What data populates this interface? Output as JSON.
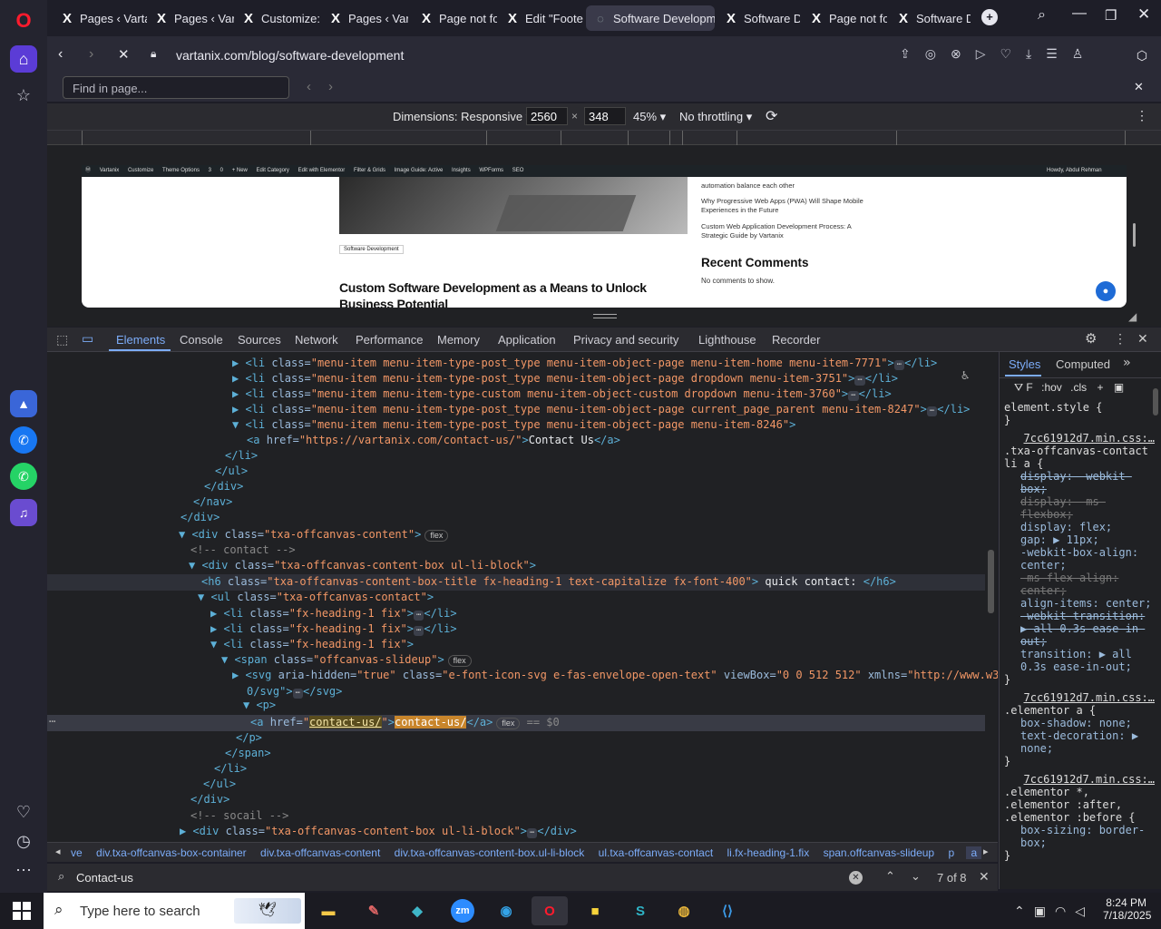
{
  "tabs": [
    {
      "label": "Pages ‹ Varta",
      "icon": "x"
    },
    {
      "label": "Pages ‹ Varta",
      "icon": "x"
    },
    {
      "label": "Customize: V",
      "icon": "x"
    },
    {
      "label": "Pages ‹ Varta",
      "icon": "x"
    },
    {
      "label": "Page not fou",
      "icon": "x"
    },
    {
      "label": "Edit \"Footer",
      "icon": "x"
    },
    {
      "label": "Software Developme",
      "icon": "spinner"
    },
    {
      "label": "Software De",
      "icon": "x"
    },
    {
      "label": "Page not fou",
      "icon": "x"
    },
    {
      "label": "Software De",
      "icon": "x"
    }
  ],
  "address": {
    "url": "vartanix.com/blog/software-development"
  },
  "find": {
    "placeholder": "Find in page..."
  },
  "device": {
    "dimensions": "Dimensions: Responsive",
    "width": "2560",
    "height": "348",
    "zoom": "45%",
    "throttle": "No throttling"
  },
  "page": {
    "adminbar": [
      "Vartanix",
      "Customize",
      "Theme Options",
      "3",
      "0",
      "+ New",
      "Edit Category",
      "Edit with Elementor",
      "Filter & Grids",
      "Image Guide: Active",
      "Insights",
      "WPForms",
      "SEO"
    ],
    "greeting": "Howdy, Abdul Rehman",
    "category": "Software Development",
    "post_title": "Custom Software Development as a Means to Unlock Business Potential",
    "side_top": "automation balance each other",
    "side_link1": "Why Progressive Web Apps (PWA) Will Shape Mobile Experiences in the Future",
    "side_link2": "Custom Web Application Development Process: A Strategic Guide by Vartanix",
    "recent_title": "Recent Comments",
    "recent_text": "No comments to show."
  },
  "devtools": {
    "tabs": [
      "Elements",
      "Console",
      "Sources",
      "Network",
      "Performance",
      "Memory",
      "Application",
      "Privacy and security",
      "Lighthouse",
      "Recorder"
    ],
    "side_tabs": [
      "Styles",
      "Computed"
    ],
    "filter": "F",
    "hov": ":hov",
    "cls": ".cls"
  },
  "dom": [
    {
      "pre": "▶ <li ",
      "a": "class=",
      "v": "\"menu-item menu-item-type-post_type menu-item-object-page menu-item-home menu-item-7771\"",
      "post": ">",
      "ell": true,
      "end": "</li>"
    },
    {
      "pre": "▶ <li ",
      "a": "class=",
      "v": "\"menu-item menu-item-type-post_type menu-item-object-page dropdown menu-item-3751\"",
      "post": ">",
      "ell": true,
      "end": "</li>"
    },
    {
      "pre": "▶ <li ",
      "a": "class=",
      "v": "\"menu-item menu-item-type-custom menu-item-object-custom dropdown menu-item-3760\"",
      "post": ">",
      "ell": true,
      "end": "</li>"
    },
    {
      "pre": "▶ <li ",
      "a": "class=",
      "v": "\"menu-item menu-item-type-post_type menu-item-object-page current_page_parent menu-item-8247\"",
      "post": ">",
      "ell": true,
      "end": "</li>"
    },
    {
      "pre": "▼ <li ",
      "a": "class=",
      "v": "\"menu-item menu-item-type-post_type menu-item-object-page menu-item-8246\"",
      "post": ">"
    },
    {
      "pre": "<a ",
      "a": "href=",
      "v": "\"https://vartanix.com/contact-us/\"",
      "post": ">",
      "text": "Contact Us",
      "end": "</a>"
    },
    {
      "pre": "</li>"
    },
    {
      "pre": "</ul>"
    },
    {
      "pre": "</div>"
    },
    {
      "pre": "</nav>"
    },
    {
      "pre": "</div>"
    },
    {
      "pre": "▼ <div ",
      "a": "class=",
      "v": "\"txa-offcanvas-content\"",
      "post": ">",
      "badge": "flex"
    },
    {
      "pre": "<!-- contact -->",
      "comment": true
    },
    {
      "pre": "▼ <div ",
      "a": "class=",
      "v": "\"txa-offcanvas-content-box  ul-li-block\"",
      "post": ">"
    },
    {
      "pre": "<h6 ",
      "a": "class=",
      "v": "\"txa-offcanvas-content-box-title fx-heading-1 text-capitalize fx-font-400\"",
      "post": ">",
      "text": " quick contact: ",
      "end": "</h6>"
    },
    {
      "pre": "▼ <ul ",
      "a": "class=",
      "v": "\"txa-offcanvas-contact\"",
      "post": ">"
    },
    {
      "pre": "▶ <li ",
      "a": "class=",
      "v": "\"fx-heading-1 fix\"",
      "post": ">",
      "ell": true,
      "end": "</li>"
    },
    {
      "pre": "▶ <li ",
      "a": "class=",
      "v": "\"fx-heading-1 fix\"",
      "post": ">",
      "ell": true,
      "end": "</li>"
    },
    {
      "pre": "▼ <li ",
      "a": "class=",
      "v": "\"fx-heading-1 fix\"",
      "post": ">"
    },
    {
      "pre": "▼ <span ",
      "a": "class=",
      "v": "\"offcanvas-slideup\"",
      "post": ">",
      "badge": "flex"
    },
    {
      "pre": "▶ <svg ",
      "a": "aria-hidden=",
      "v": "\"true\"",
      "a2": " class=",
      "v2": "\"e-font-icon-svg e-fas-envelope-open-text\"",
      "a3": " viewBox=",
      "v3": "\"0 0 512 512\"",
      "a4": " xmlns=",
      "v4": "\"http://www.w3.org/200"
    },
    {
      "pre": "0/svg\"",
      "post": ">",
      "ell": true,
      "end": "</svg>",
      "cont": true
    },
    {
      "pre": "▼ <p>"
    },
    {
      "pre": "<a ",
      "a": "href=",
      "v": "\"contact-us/\"",
      "post": ">",
      "text": "contact-us/",
      "end": "</a>",
      "badge": "flex",
      "dollar": " == $0",
      "selected": true
    },
    {
      "pre": "</p>"
    },
    {
      "pre": "</span>"
    },
    {
      "pre": "</li>"
    },
    {
      "pre": "</ul>"
    },
    {
      "pre": "</div>"
    },
    {
      "pre": "<!-- socail -->",
      "comment": true
    },
    {
      "pre": "▶ <div ",
      "a": "class=",
      "v": "\"txa-offcanvas-content-box ul-li-block\"",
      "post": ">",
      "ell": true,
      "end": "</div>"
    }
  ],
  "styles": {
    "element_style": "element.style {",
    "r1_src": "7cc61912d7.min.css:…",
    "r1_sel": ".txa-offcanvas-contact li a {",
    "r1_props": [
      {
        "t": "display: -webkit-box;",
        "s": true
      },
      {
        "t": "display: -ms-flexbox;",
        "s": true,
        "dim": true
      },
      {
        "t": "display: flex;",
        "s": false
      },
      {
        "t": "gap: ▶ 11px;",
        "s": false
      },
      {
        "t": "-webkit-box-align: center;",
        "s": false
      },
      {
        "t": "-ms-flex-align: center;",
        "s": true,
        "dim": true
      },
      {
        "t": "align-items: center;",
        "s": false
      },
      {
        "t": "-webkit-transition: ▶ all 0.3s ease-in-out;",
        "s": true
      },
      {
        "t": "transition: ▶ all 0.3s ease-in-out;",
        "s": false
      }
    ],
    "r2_src": "7cc61912d7.min.css:…",
    "r2_sel": ".elementor a {",
    "r2_props": [
      "box-shadow: none;",
      "text-decoration: ▶ none;"
    ],
    "r3_src": "7cc61912d7.min.css:…",
    "r3_sel": ".elementor *, .elementor :after, .elementor :before {",
    "r3_props": [
      "box-sizing: border-box;"
    ]
  },
  "breadcrumbs": [
    "ve",
    "div.txa-offcanvas-box-container",
    "div.txa-offcanvas-content",
    "div.txa-offcanvas-content-box.ul-li-block",
    "ul.txa-offcanvas-contact",
    "li.fx-heading-1.fix",
    "span.offcanvas-slideup",
    "p",
    "a"
  ],
  "search": {
    "value": "Contact-us",
    "count": "7 of 8"
  },
  "taskbar": {
    "search_placeholder": "Type here to search",
    "time": "8:24 PM",
    "date": "7/18/2025"
  },
  "colors": {
    "accent": "#ff1b2d",
    "dev_blue": "#7cacf8",
    "highlight": "#5a4d1e"
  }
}
